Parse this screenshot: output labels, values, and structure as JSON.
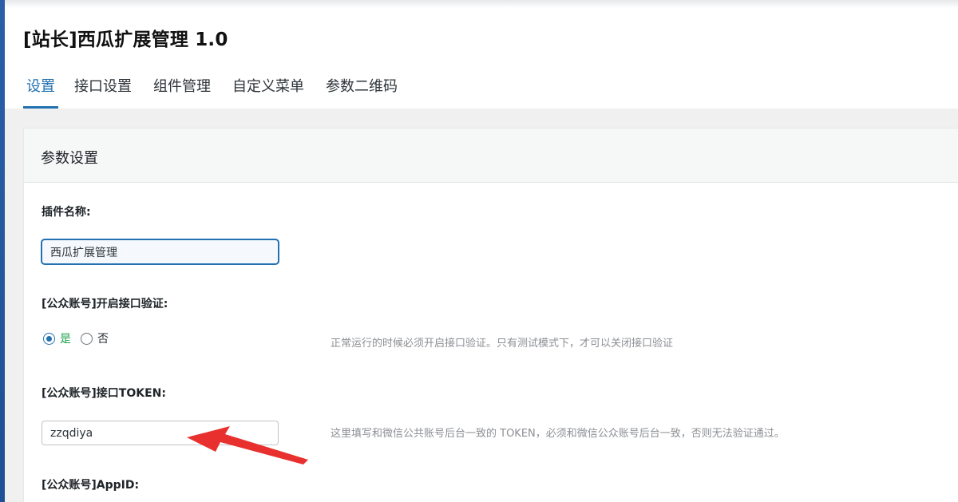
{
  "page": {
    "title": "[站长]西瓜扩展管理 1.0"
  },
  "tabs": [
    {
      "label": "设置",
      "active": true
    },
    {
      "label": "接口设置",
      "active": false
    },
    {
      "label": "组件管理",
      "active": false
    },
    {
      "label": "自定义菜单",
      "active": false
    },
    {
      "label": "参数二维码",
      "active": false
    }
  ],
  "panel": {
    "title": "参数设置"
  },
  "fields": {
    "plugin_name": {
      "label": "插件名称:",
      "value": "西瓜扩展管理"
    },
    "interface_verify": {
      "label": "[公众账号]开启接口验证:",
      "options": [
        "是",
        "否"
      ],
      "selected": "是",
      "help": "正常运行的时候必须开启接口验证。只有测试模式下，才可以关闭接口验证"
    },
    "token": {
      "label": "[公众账号]接口TOKEN:",
      "value": "zzqdiya",
      "help": "这里填写和微信公共账号后台一致的 TOKEN，必须和微信公众账号后台一致，否则无法验证通过。"
    },
    "appid": {
      "label": "[公众账号]AppID:"
    }
  },
  "colors": {
    "accent": "#2271b1",
    "yes_label": "#1aa14a",
    "annotation_arrow": "#e8312f"
  },
  "icons": {
    "annotation": "red-arrow-icon"
  }
}
